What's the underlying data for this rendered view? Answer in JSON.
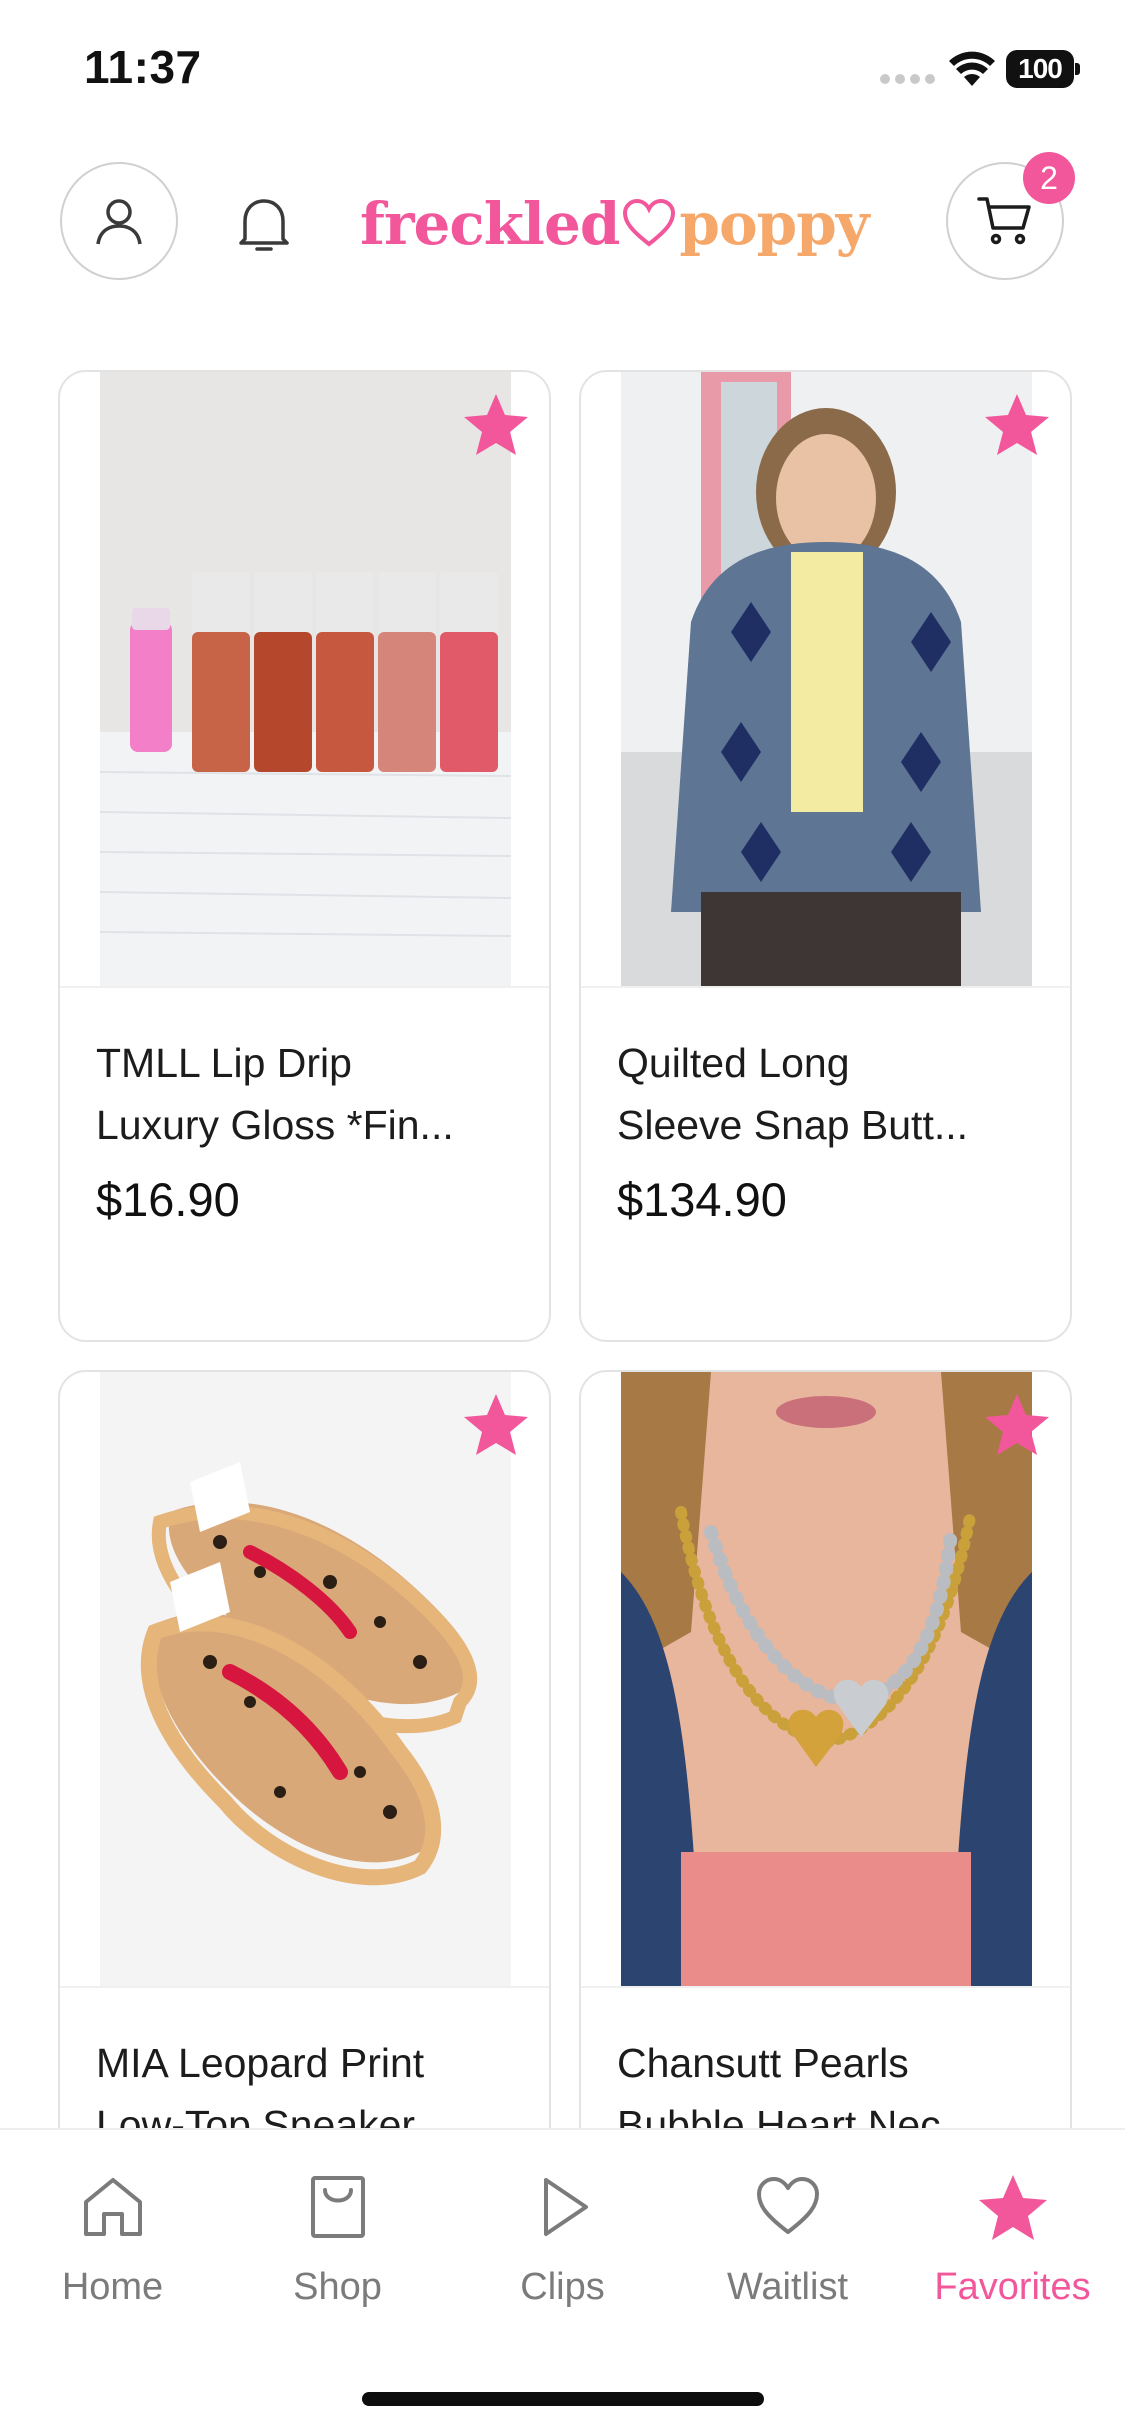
{
  "status_bar": {
    "time": "11:37",
    "battery": "100"
  },
  "header": {
    "logo_part1": "freckled",
    "logo_part2": "poppy",
    "cart_count": "2"
  },
  "products": [
    {
      "title_line1": "TMLL Lip Drip",
      "title_line2": "Luxury Gloss *Fin...",
      "price": "$16.90",
      "image": "lip-gloss-photo",
      "favorited": true
    },
    {
      "title_line1": "Quilted Long",
      "title_line2": "Sleeve Snap Butt...",
      "price": "$134.90",
      "image": "quilted-jacket-photo",
      "favorited": true
    },
    {
      "title_line1": "MIA Leopard Print",
      "title_line2": "Low-Top Sneaker",
      "price": "",
      "image": "leopard-sneakers-photo",
      "favorited": true
    },
    {
      "title_line1": "Chansutt Pearls",
      "title_line2": "Bubble Heart Nec...",
      "price": "",
      "image": "heart-necklace-photo",
      "favorited": true
    }
  ],
  "tabs": [
    {
      "label": "Home",
      "icon": "home-icon",
      "active": false
    },
    {
      "label": "Shop",
      "icon": "shopping-bag-icon",
      "active": false
    },
    {
      "label": "Clips",
      "icon": "play-icon",
      "active": false
    },
    {
      "label": "Waitlist",
      "icon": "heart-icon",
      "active": false
    },
    {
      "label": "Favorites",
      "icon": "star-icon",
      "active": true
    }
  ],
  "colors": {
    "accent": "#f2579b",
    "inactive_tab": "#7b7b7b",
    "border": "#e3e3e3"
  }
}
